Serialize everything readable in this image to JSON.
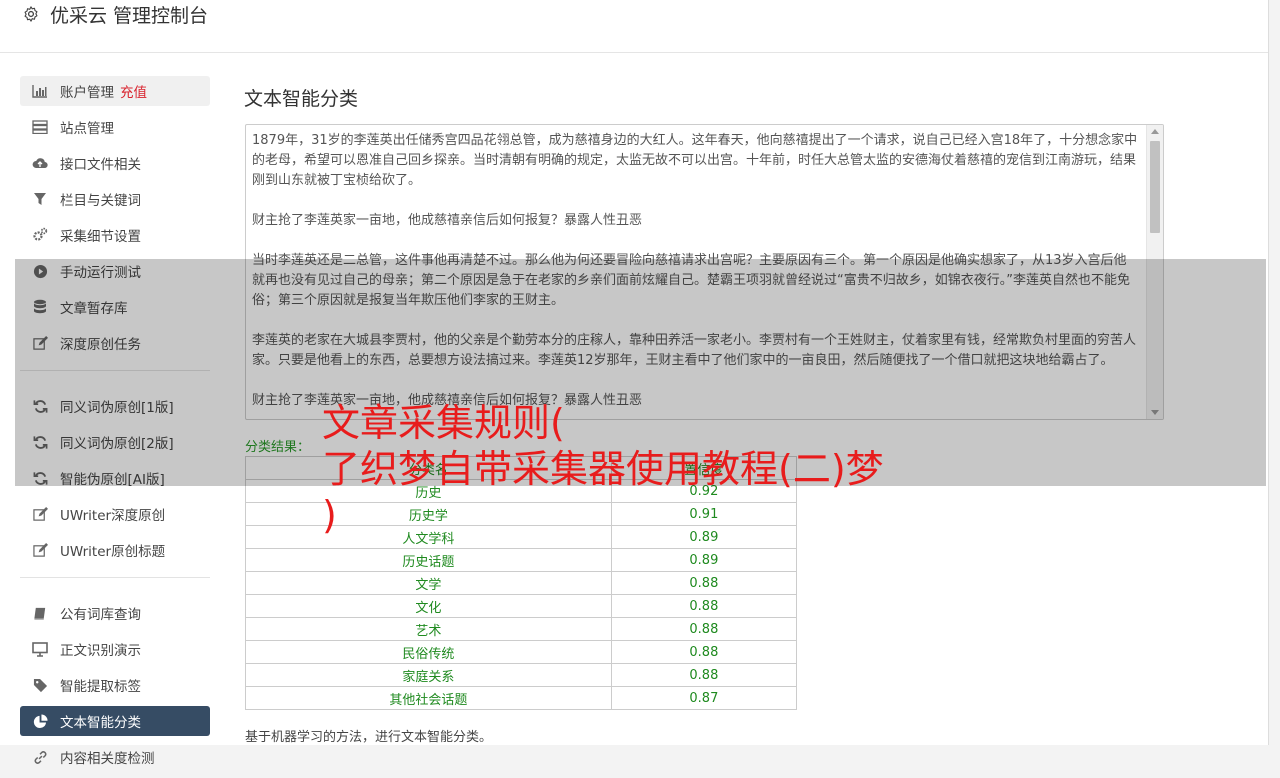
{
  "header": {
    "title": "优采云 管理控制台"
  },
  "sidebar": {
    "items": [
      {
        "label": "账户管理",
        "badge": "充值",
        "icon": "bar-chart-icon"
      },
      {
        "label": "站点管理",
        "icon": "server-icon"
      },
      {
        "label": "接口文件相关",
        "icon": "cloud-upload-icon"
      },
      {
        "label": "栏目与关键词",
        "icon": "filter-icon"
      },
      {
        "label": "采集细节设置",
        "icon": "gears-icon"
      },
      {
        "label": "手动运行测试",
        "icon": "play-circle-icon"
      },
      {
        "label": "文章暂存库",
        "icon": "database-icon"
      },
      {
        "label": "深度原创任务",
        "icon": "edit-icon"
      }
    ],
    "items2": [
      {
        "label": "同义词伪原创[1版]",
        "icon": "refresh-icon"
      },
      {
        "label": "同义词伪原创[2版]",
        "icon": "refresh-icon"
      },
      {
        "label": "智能伪原创[AI版]",
        "icon": "refresh-icon"
      },
      {
        "label": "UWriter深度原创",
        "icon": "edit-icon"
      },
      {
        "label": "UWriter原创标题",
        "icon": "edit-icon"
      }
    ],
    "items3": [
      {
        "label": "公有词库查询",
        "icon": "book-icon"
      },
      {
        "label": "正文识别演示",
        "icon": "monitor-icon"
      },
      {
        "label": "智能提取标签",
        "icon": "tag-icon"
      },
      {
        "label": "文本智能分类",
        "icon": "pie-chart-icon",
        "active": true
      },
      {
        "label": "内容相关度检测",
        "icon": "link-icon"
      }
    ]
  },
  "main": {
    "title": "文本智能分类",
    "text": [
      "1879年，31岁的李莲英出任储秀宫四品花翎总管，成为慈禧身边的大红人。这年春天，他向慈禧提出了一个请求，说自己已经入宫18年了，十分想念家中的老母，希望可以恩准自己回乡探亲。当时清朝有明确的规定，太监无故不可以出宫。十年前，时任大总管太监的安德海仗着慈禧的宠信到江南游玩，结果刚到山东就被丁宝桢给砍了。",
      "财主抢了李莲英家一亩地，他成慈禧亲信后如何报复？暴露人性丑恶",
      "当时李莲英还是二总管，这件事他再清楚不过。那么他为何还要冒险向慈禧请求出宫呢？主要原因有三个。第一个原因是他确实想家了，从13岁入宫后他就再也没有见过自己的母亲；第二个原因是急于在老家的乡亲们面前炫耀自己。楚霸王项羽就曾经说过“富贵不归故乡，如锦衣夜行。”李莲英自然也不能免俗；第三个原因就是报复当年欺压他们李家的王财主。",
      "李莲英的老家在大城县李贾村，他的父亲是个勤劳本分的庄稼人，靠种田养活一家老小。李贾村有一个王姓财主，仗着家里有钱，经常欺负村里面的穷苦人家。只要是他看上的东西，总要想方设法搞过来。李莲英12岁那年，王财主看中了他们家中的一亩良田，然后随便找了一个借口就把这块地给霸占了。",
      "财主抢了李莲英家一亩地，他成慈禧亲信后如何报复？暴露人性丑恶"
    ],
    "result_label": "分类结果：",
    "table": {
      "headers": [
        "分类名",
        "置信度"
      ],
      "rows": [
        [
          "历史",
          "0.92"
        ],
        [
          "历史学",
          "0.91"
        ],
        [
          "人文学科",
          "0.89"
        ],
        [
          "历史话题",
          "0.89"
        ],
        [
          "文学",
          "0.88"
        ],
        [
          "文化",
          "0.88"
        ],
        [
          "艺术",
          "0.88"
        ],
        [
          "民俗传统",
          "0.88"
        ],
        [
          "家庭关系",
          "0.88"
        ],
        [
          "其他社会话题",
          "0.87"
        ]
      ]
    },
    "footer_note": "基于机器学习的方法，进行文本智能分类。"
  },
  "overlay": {
    "line1": "文章采集规则(",
    "line2": "了织梦自带采集器使用教程(二)梦",
    "line3": ")"
  }
}
